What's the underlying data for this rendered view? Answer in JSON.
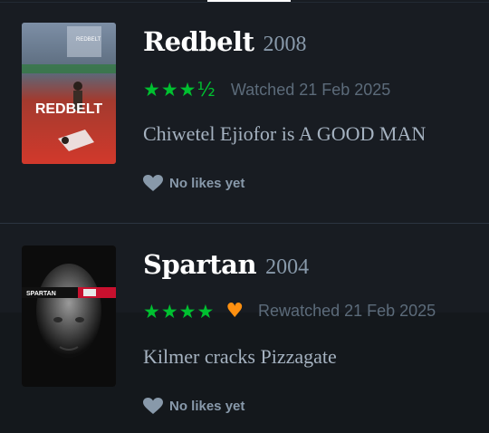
{
  "entries": [
    {
      "title": "Redbelt",
      "year": "2008",
      "stars": "★★★½",
      "rating_value": 3.5,
      "liked": false,
      "watched_label": "Watched 21 Feb 2025",
      "review": "Chiwetel Ejiofor is A GOOD MAN",
      "likes_label": "No likes yet",
      "poster": {
        "alt": "Redbelt poster",
        "logo_text": "REDBELT",
        "small_text": "REDBELT",
        "colors": {
          "top": "#6e7f93",
          "bottom": "#c0322a"
        }
      }
    },
    {
      "title": "Spartan",
      "year": "2004",
      "stars": "★★★★",
      "rating_value": 4,
      "liked": true,
      "liked_icon": "heart-icon",
      "watched_label": "Rewatched 21 Feb 2025",
      "review": "Kilmer cracks Pizzagate",
      "likes_label": "No likes yet",
      "poster": {
        "alt": "Spartan poster",
        "logo_text": "SPARTAN",
        "colors": {
          "top": "#0d0d0d",
          "bottom": "#3a3a3a",
          "accent": "#c8102e"
        }
      }
    }
  ],
  "colors": {
    "background": "#14181c",
    "star": "#00c030",
    "liked_heart": "#ff9010",
    "muted": "#8899aa"
  }
}
